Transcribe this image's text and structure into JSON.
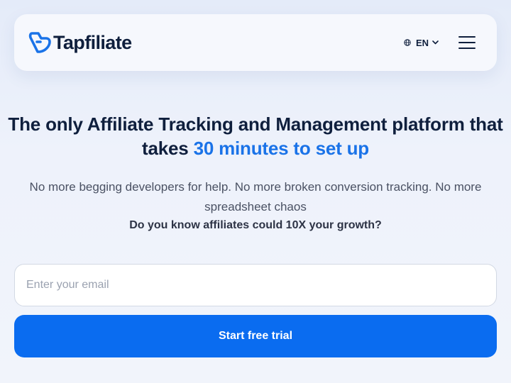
{
  "header": {
    "logo_text": "Tapfiliate",
    "language": "EN",
    "icons": {
      "logo": "tapfiliate-logo-icon",
      "language": "globe-icon",
      "language_dropdown": "chevron-down-icon",
      "menu": "hamburger-menu-icon"
    }
  },
  "hero": {
    "title_main": "The only Affiliate Tracking and Management platform that takes",
    "title_highlight": "30 minutes to set up",
    "subtitle": "No more begging developers for help. No more broken conversion tracking. No more spreadsheet chaos",
    "question": "Do you know affiliates could 10X your growth?"
  },
  "signup": {
    "email_placeholder": "Enter your email",
    "email_value": "",
    "cta_label": "Start free trial"
  },
  "colors": {
    "brand_blue": "#0a6cf0",
    "accent_text": "#1a73e8",
    "dark_text": "#0f1f3d",
    "muted_text": "#4a5163"
  }
}
